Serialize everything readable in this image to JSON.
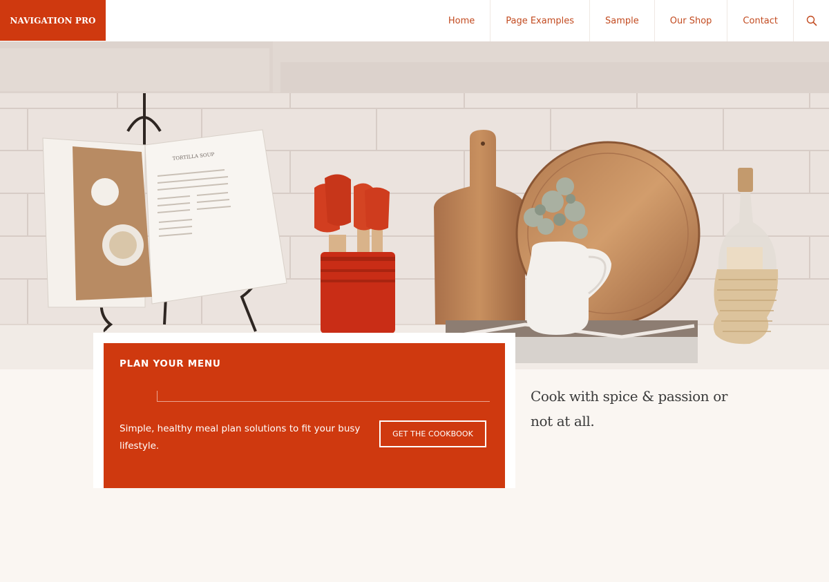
{
  "header": {
    "logo": "NAVIGATION PRO",
    "nav": [
      {
        "label": "Home"
      },
      {
        "label": "Page Examples"
      },
      {
        "label": "Sample"
      },
      {
        "label": "Our Shop"
      },
      {
        "label": "Contact"
      }
    ],
    "search_icon": "search-icon"
  },
  "hero": {
    "book_page_title": "TORTILLA SOUP"
  },
  "card": {
    "title": "PLAN YOUR MENU",
    "text": "Simple, healthy meal plan solutions to fit your busy lifestyle.",
    "button_label": "GET THE COOKBOOK"
  },
  "tagline": "Cook with spice & passion or not at all.",
  "colors": {
    "accent": "#cf390f",
    "nav_text": "#c24a1f",
    "background": "#faf6f2"
  }
}
